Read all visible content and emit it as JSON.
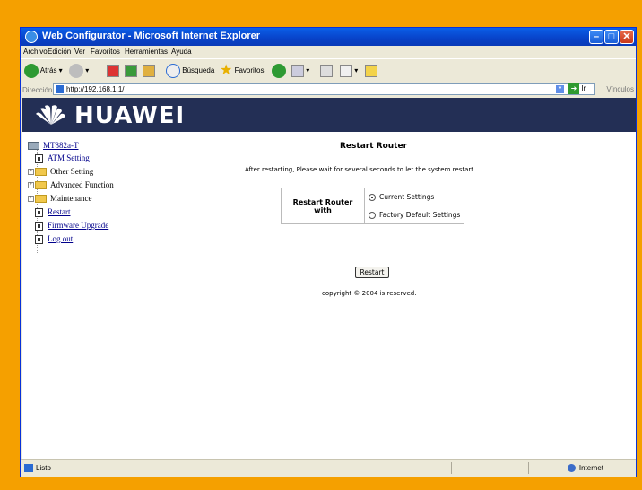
{
  "window": {
    "title": "Web Configurator - Microsoft Internet Explorer"
  },
  "menu": [
    "Archivo",
    "Edición",
    "Ver",
    "Favoritos",
    "Herramientas",
    "Ayuda"
  ],
  "toolbar": {
    "back": "Atrás",
    "search": "Búsqueda",
    "favorites": "Favoritos"
  },
  "address": {
    "label": "Dirección",
    "url": "http://192.168.1.1/",
    "go": "Ir",
    "links": "Vínculos"
  },
  "banner": {
    "brand": "HUAWEI"
  },
  "nav": {
    "root": "MT882a-T",
    "items": [
      {
        "label": "ATM Setting"
      },
      {
        "label": "Other Setting"
      },
      {
        "label": "Advanced Function"
      },
      {
        "label": "Maintenance"
      },
      {
        "label": "Restart"
      },
      {
        "label": "Firmware Upgrade"
      },
      {
        "label": "Log out"
      }
    ]
  },
  "main": {
    "title": "Restart Router",
    "message": "After restarting, Please wait for several seconds to let the system restart.",
    "restart_with_label": "Restart Router with",
    "options": [
      "Current Settings",
      "Factory Default Settings"
    ],
    "selected_option": "Current Settings",
    "button": "Restart",
    "copyright": "copyright © 2004 is reserved."
  },
  "status": {
    "left": "Listo",
    "zone": "Internet"
  },
  "colors": {
    "banner": "#232f55",
    "frame": "#f5a000",
    "titlebar": "#0a5fe8",
    "link": "#00008b"
  }
}
